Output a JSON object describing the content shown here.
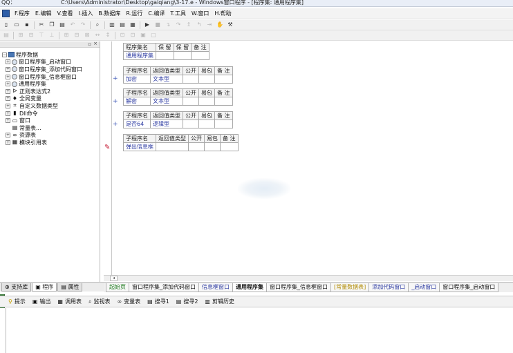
{
  "window": {
    "qq_label": "QQ：",
    "title": "C:\\Users\\Administrator\\Desktop\\gaiqiang\\3-17.e - Windows窗口程序 - [程序集: 通用程序集]"
  },
  "menubar": {
    "items": [
      "F.程序",
      "E.编辑",
      "V.查看",
      "I.插入",
      "B.数据库",
      "R.运行",
      "C.编译",
      "T.工具",
      "W.窗口",
      "H.帮助"
    ]
  },
  "toolbar1": {
    "icons": [
      "new-file-icon",
      "open-file-icon",
      "save-file-icon",
      "cut-icon",
      "copy-icon",
      "paste-icon",
      "undo-icon",
      "redo-icon",
      "find-icon",
      "layout1-icon",
      "layout2-icon",
      "layout3-icon",
      "run-icon",
      "stop-icon",
      "step-into-icon",
      "step-over-icon",
      "step-out-icon",
      "step-back-icon",
      "run-to-icon",
      "hand-icon",
      "hammer-icon"
    ]
  },
  "left_panel": {
    "root_label": "程序数据",
    "items": [
      {
        "label": "窗口程序集_启动窗口",
        "icon": "module-icon"
      },
      {
        "label": "窗口程序集_添加代码窗口",
        "icon": "module-icon"
      },
      {
        "label": "窗口程序集_信息框窗口",
        "icon": "module-icon"
      },
      {
        "label": "通用程序集",
        "icon": "module-icon"
      },
      {
        "label": "正则表达式2",
        "icon": "class-icon"
      },
      {
        "label": "全局变量",
        "icon": "variable-icon"
      },
      {
        "label": "自定义数据类型",
        "icon": "type-icon"
      },
      {
        "label": "Dll命令",
        "icon": "dll-icon"
      },
      {
        "label": "窗口",
        "icon": "window-icon"
      },
      {
        "label": "常量表...",
        "icon": "constant-icon"
      },
      {
        "label": "资源表",
        "icon": "resource-icon"
      },
      {
        "label": "模块引用表",
        "icon": "module-ref-icon"
      }
    ],
    "tabs": [
      "支持库",
      "程序",
      "属性"
    ]
  },
  "editor": {
    "assembly_table": {
      "headers": [
        "程序集名",
        "保 留",
        "保 留",
        "备 注"
      ],
      "values": [
        "通用程序集",
        "",
        "",
        ""
      ]
    },
    "subroutines": [
      {
        "headers": [
          "子程序名",
          "返回值类型",
          "公开",
          "易包",
          "备 注"
        ],
        "values": [
          "加密",
          "文本型",
          "",
          "",
          ""
        ]
      },
      {
        "headers": [
          "子程序名",
          "返回值类型",
          "公开",
          "易包",
          "备 注"
        ],
        "values": [
          "解密",
          "文本型",
          "",
          "",
          ""
        ]
      },
      {
        "headers": [
          "子程序名",
          "返回值类型",
          "公开",
          "易包",
          "备 注"
        ],
        "values": [
          "是否64",
          "逻辑型",
          "",
          "",
          ""
        ]
      },
      {
        "headers": [
          "子程序名",
          "返回值类型",
          "公开",
          "易包",
          "备 注"
        ],
        "values": [
          "弹出信息框",
          "",
          "",
          "",
          ""
        ]
      }
    ],
    "plus_symbol": "+",
    "pencil_symbol": "✎"
  },
  "doc_tabs": [
    {
      "label": "起始页",
      "active": false,
      "color": "#1c7a1c"
    },
    {
      "label": "窗口程序集_添加代码窗口",
      "active": false,
      "color": "#222222"
    },
    {
      "label": "信息框窗口",
      "active": false,
      "color": "#2d3ba2"
    },
    {
      "label": "通用程序集",
      "active": true,
      "color": "#111111"
    },
    {
      "label": "窗口程序集_信息框窗口",
      "active": false,
      "color": "#222222"
    },
    {
      "label": "[常量数据表]",
      "active": false,
      "color": "#b08a00"
    },
    {
      "label": "添加代码窗口",
      "active": false,
      "color": "#2d3ba2"
    },
    {
      "label": "_启动窗口",
      "active": false,
      "color": "#2d3ba2"
    },
    {
      "label": "窗口程序集_启动窗口",
      "active": false,
      "color": "#222222"
    }
  ],
  "output_tabs": [
    {
      "label": "提示",
      "icon": "bulb-icon"
    },
    {
      "label": "输出",
      "icon": "output-icon"
    },
    {
      "label": "调用表",
      "icon": "callstack-icon"
    },
    {
      "label": "监视表",
      "icon": "watch-icon"
    },
    {
      "label": "变量表",
      "icon": "variables-icon"
    },
    {
      "label": "搜寻1",
      "icon": "search1-icon"
    },
    {
      "label": "搜寻2",
      "icon": "search2-icon"
    },
    {
      "label": "剪辑历史",
      "icon": "clipboard-icon"
    }
  ]
}
